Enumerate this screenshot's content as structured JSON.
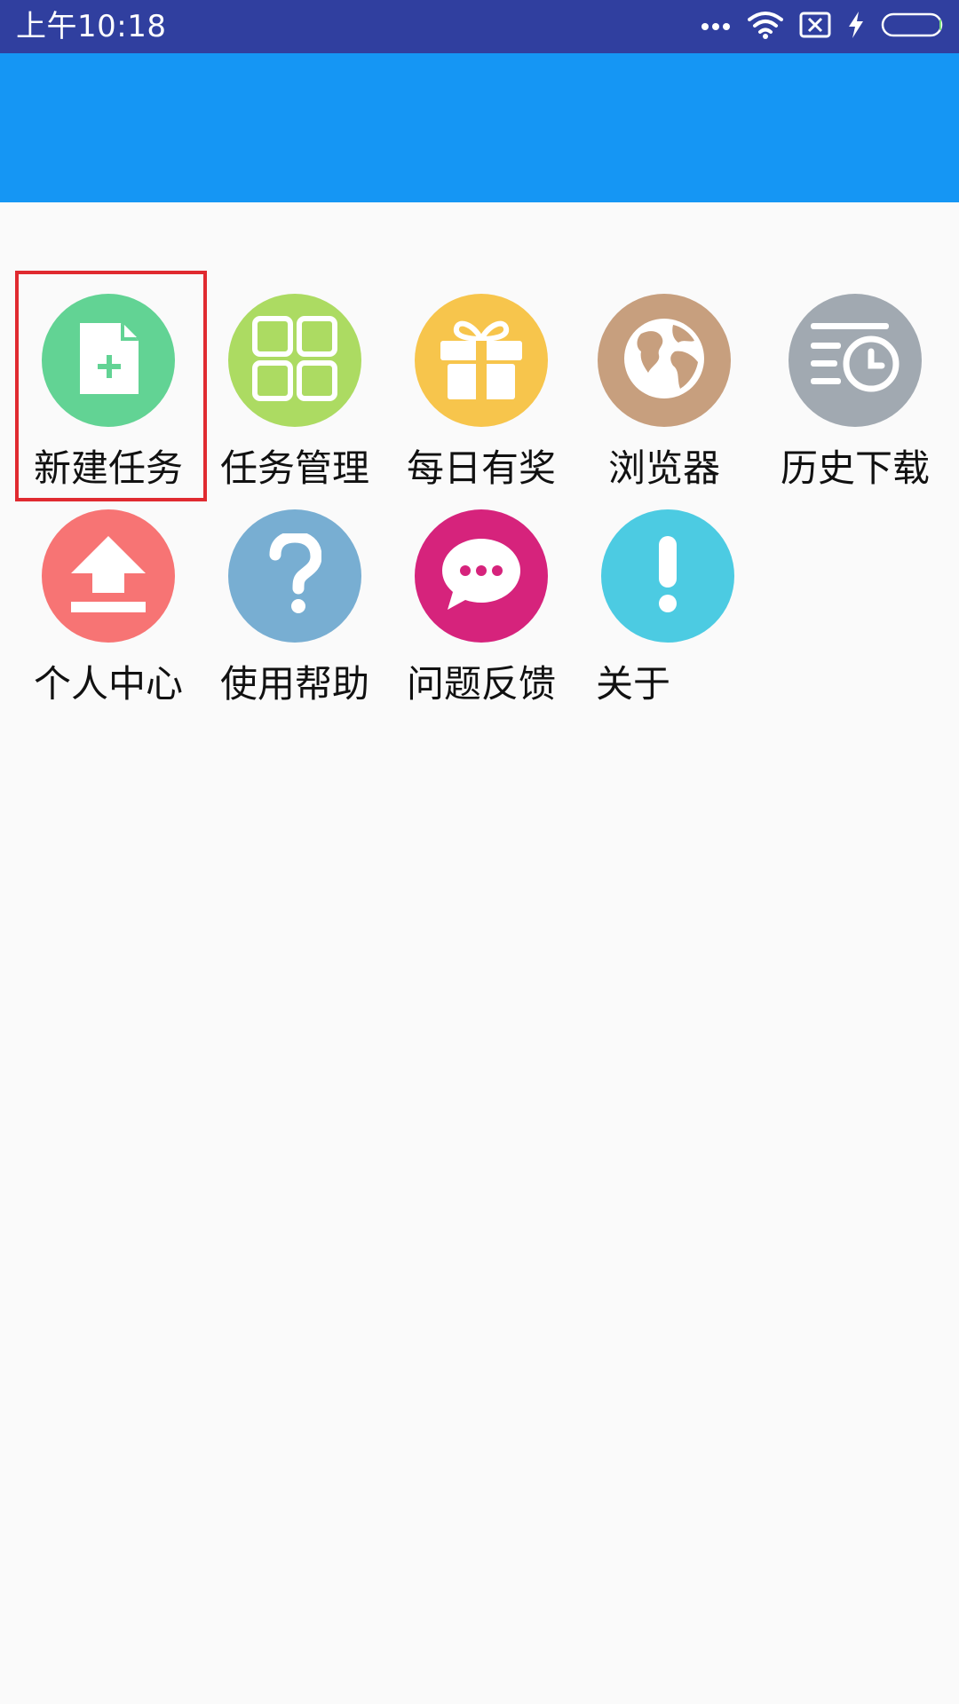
{
  "status_bar": {
    "time": "上午10:18",
    "icons": [
      "more-dots-icon",
      "wifi-icon",
      "sim-x-icon",
      "charging-bolt-icon",
      "battery-icon"
    ]
  },
  "colors": {
    "status_bar": "#303f9f",
    "toolbar": "#1596f4",
    "background": "#fafafa",
    "selection": "#e02a30"
  },
  "grid": [
    {
      "id": "new-task",
      "label": "新建任务",
      "icon": "new-file-icon",
      "color": "#62d394"
    },
    {
      "id": "task-management",
      "label": "任务管理",
      "icon": "grid-icon",
      "color": "#acdb62"
    },
    {
      "id": "daily-reward",
      "label": "每日有奖",
      "icon": "gift-icon",
      "color": "#f7c54c"
    },
    {
      "id": "browser",
      "label": "浏览器",
      "icon": "globe-icon",
      "color": "#c79f7e"
    },
    {
      "id": "download-history",
      "label": "历史下载",
      "icon": "history-clock-icon",
      "color": "#a1a9b1"
    },
    {
      "id": "personal-center",
      "label": "个人中心",
      "icon": "upload-icon",
      "color": "#f77474"
    },
    {
      "id": "help",
      "label": "使用帮助",
      "icon": "question-icon",
      "color": "#78aed2"
    },
    {
      "id": "feedback",
      "label": "问题反馈",
      "icon": "chat-bubble-icon",
      "color": "#d6237c"
    },
    {
      "id": "about",
      "label": "关于",
      "icon": "exclamation-icon",
      "color": "#4ccbe2"
    }
  ]
}
